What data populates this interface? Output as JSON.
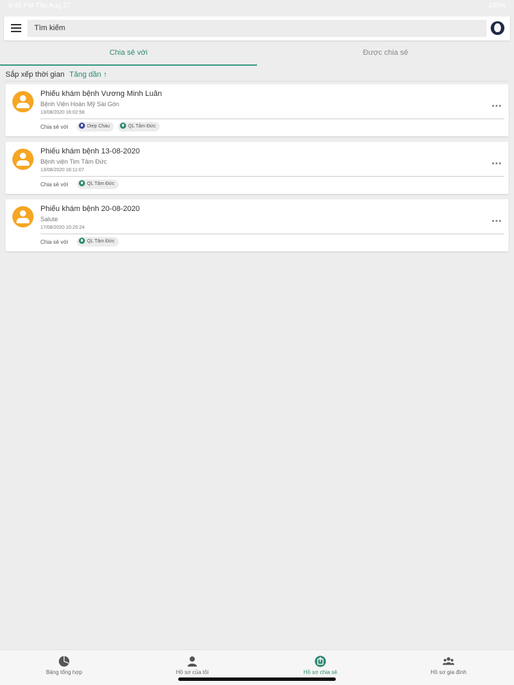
{
  "status_bar": {
    "time_date": "9:48 PM  Thu Aug 27",
    "battery": "100%"
  },
  "search": {
    "value": "Tìm kiếm"
  },
  "tabs": [
    {
      "label": "Chia sẻ với",
      "active": true
    },
    {
      "label": "Được chia sẻ",
      "active": false
    }
  ],
  "sort": {
    "label": "Sắp xếp thời gian",
    "value": "Tăng dần",
    "arrow": "↑"
  },
  "cards": [
    {
      "title": "Phiếu khám bệnh Vương Minh Luân",
      "subtitle": "Bệnh Viện Hoàn Mỹ Sài Gòn",
      "date": "13/08/2020 16:02:58",
      "share_label": "Chia sẻ với",
      "chips": [
        {
          "name": "Diep Chau",
          "color": "#3b4a9a"
        },
        {
          "name": "QL Tâm Đức",
          "color": "#2e8a72"
        }
      ]
    },
    {
      "title": "Phiếu khám bệnh 13-08-2020",
      "subtitle": "Bệnh viện Tim Tâm Đức",
      "date": "13/08/2020 16:11:07",
      "share_label": "Chia sẻ với",
      "chips": [
        {
          "name": "QL Tâm Đức",
          "color": "#2e8a72"
        }
      ]
    },
    {
      "title": "Phiếu khám bệnh 20-08-2020",
      "subtitle": "Salute",
      "date": "17/08/2020 10:20:24",
      "share_label": "Chia sẻ với",
      "chips": [
        {
          "name": "QL Tâm Đức",
          "color": "#2e8a72"
        }
      ]
    }
  ],
  "bottom_nav": [
    {
      "label": "Bảng tổng hợp",
      "icon": "pie-chart-icon",
      "active": false
    },
    {
      "label": "Hồ sơ của tôi",
      "icon": "person-icon",
      "active": false
    },
    {
      "label": "Hồ sơ chia sẻ",
      "icon": "share-file-icon",
      "active": true
    },
    {
      "label": "Hồ sơ gia đình",
      "icon": "group-icon",
      "active": false
    }
  ],
  "colors": {
    "accent": "#2e8a72",
    "card_icon": "#f5a623",
    "background": "#ededed"
  }
}
